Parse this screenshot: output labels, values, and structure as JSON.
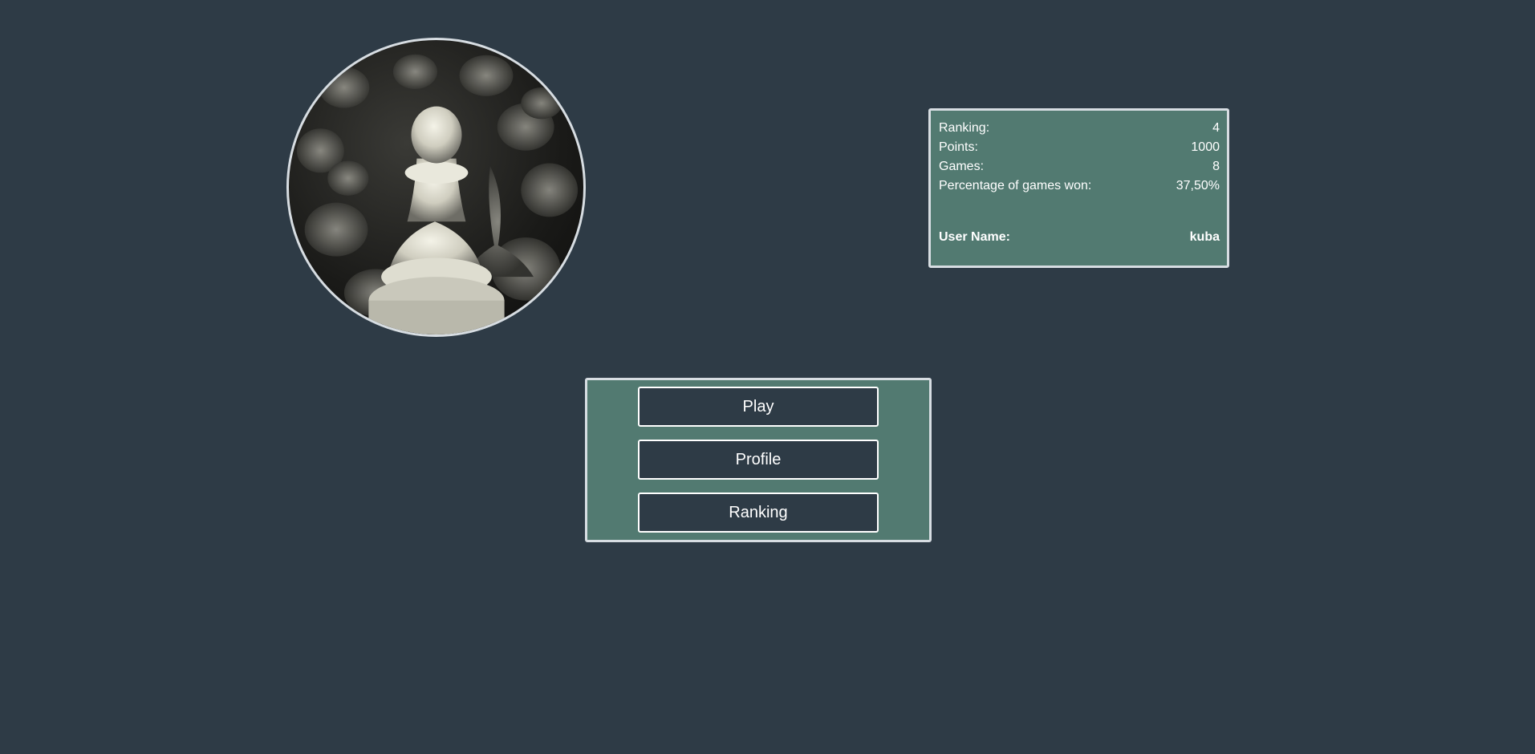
{
  "avatar": {
    "icon": "chess-pawn-image"
  },
  "stats": {
    "rows": [
      {
        "label": "Ranking:",
        "value": "4"
      },
      {
        "label": "Points:",
        "value": "1000"
      },
      {
        "label": "Games:",
        "value": "8"
      },
      {
        "label": "Percentage of games won:",
        "value": "37,50%"
      }
    ],
    "username_label": "User Name:",
    "username_value": "kuba"
  },
  "menu": {
    "play_label": "Play",
    "profile_label": "Profile",
    "ranking_label": "Ranking"
  },
  "colors": {
    "background": "#2e3b46",
    "panel": "#527a71",
    "border": "#d7dde2",
    "text": "#ffffff"
  }
}
